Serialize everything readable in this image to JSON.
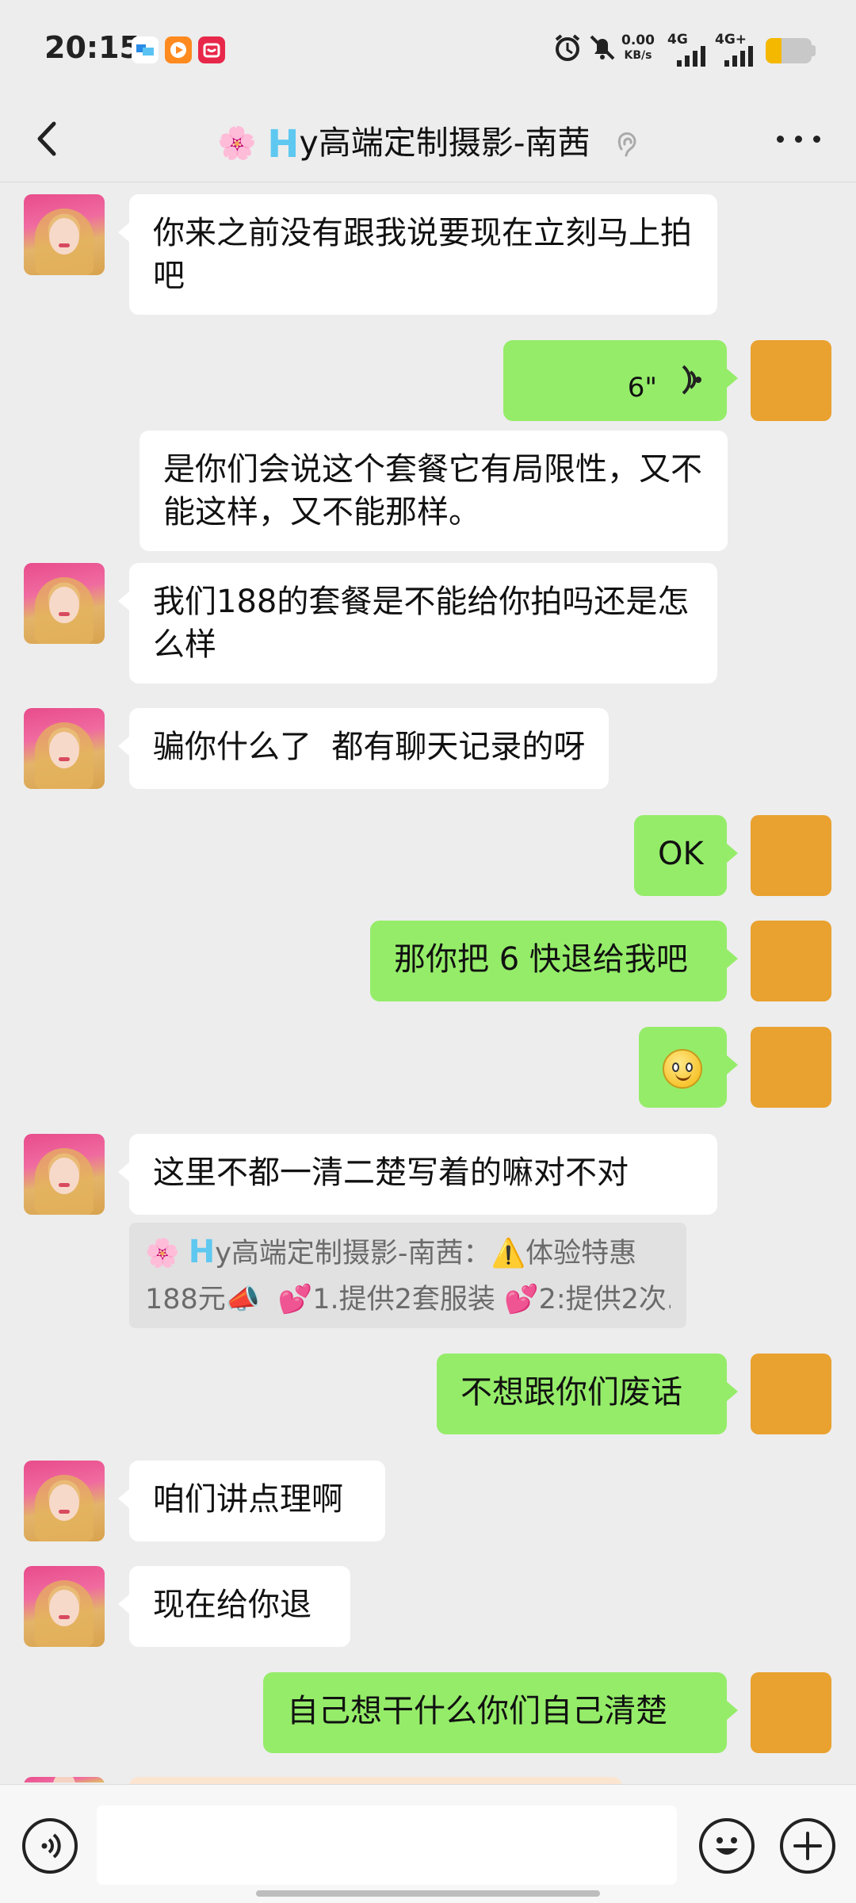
{
  "status_bar": {
    "time": "20:15",
    "net_speed_value": "0.00",
    "net_speed_unit": "KB/s",
    "signal1_label": "4G",
    "signal2_label": "4G+",
    "battery_percent": 35,
    "accent_battery": "#f5b800"
  },
  "nav": {
    "back_icon": "chevron-left-icon",
    "title_emoji": "🌸",
    "title_h": "H",
    "title_text": "y高端定制摄影-南茜",
    "ear_icon": "ear-icon",
    "more_icon": "more-dots-icon"
  },
  "messages": [
    {
      "side": "left",
      "text": "你来之前没有跟我说要现在立刻马上拍吧"
    },
    {
      "side": "right",
      "type": "voice",
      "duration": "6\""
    },
    {
      "side": "left",
      "text": "是你们会说这个套餐它有局限性，又不能这样，又不能那样。"
    },
    {
      "side": "left",
      "text": "我们188的套餐是不能给你拍吗还是怎么样"
    },
    {
      "side": "left",
      "text": "骗你什么了  都有聊天记录的呀"
    },
    {
      "side": "right",
      "text": "OK"
    },
    {
      "side": "right",
      "text": "那你把 6 快退给我吧"
    },
    {
      "side": "right",
      "type": "emoji",
      "emoji": "smile-icon"
    },
    {
      "side": "left",
      "text": "这里不都一清二楚写着的嘛对不对"
    },
    {
      "side": "right",
      "text": "不想跟你们废话"
    },
    {
      "side": "left",
      "text": "咱们讲点理啊"
    },
    {
      "side": "left",
      "text": "现在给你退"
    },
    {
      "side": "right",
      "text": "自己想干什么你们自己清楚"
    }
  ],
  "quote": {
    "prefix_emoji": "🌸",
    "h": "H",
    "sender": "y高端定制摄影-南茜：",
    "warn": "⚠️",
    "line1_rest": "体验特惠",
    "line2": "188元📣  💕1.提供2套服装 💕2:提供2次..."
  },
  "input_bar": {
    "voice_icon": "voice-input-icon",
    "placeholder": "",
    "emoji_icon": "emoji-icon",
    "plus_icon": "plus-icon"
  },
  "colors": {
    "background": "#ededed",
    "my_bubble": "#95ec69",
    "their_bubble": "#ffffff",
    "my_avatar": "#e9a12f"
  }
}
